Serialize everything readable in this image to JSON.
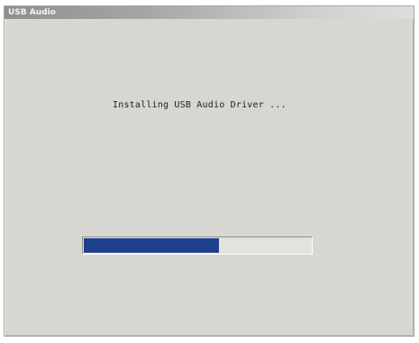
{
  "window": {
    "title": "USB Audio"
  },
  "status_text": "Installing USB Audio Driver ...",
  "progress": {
    "fraction": 0.6
  },
  "colors": {
    "dialog_background": "#d8d6d0",
    "progress_fill": "#1e3f8c"
  }
}
